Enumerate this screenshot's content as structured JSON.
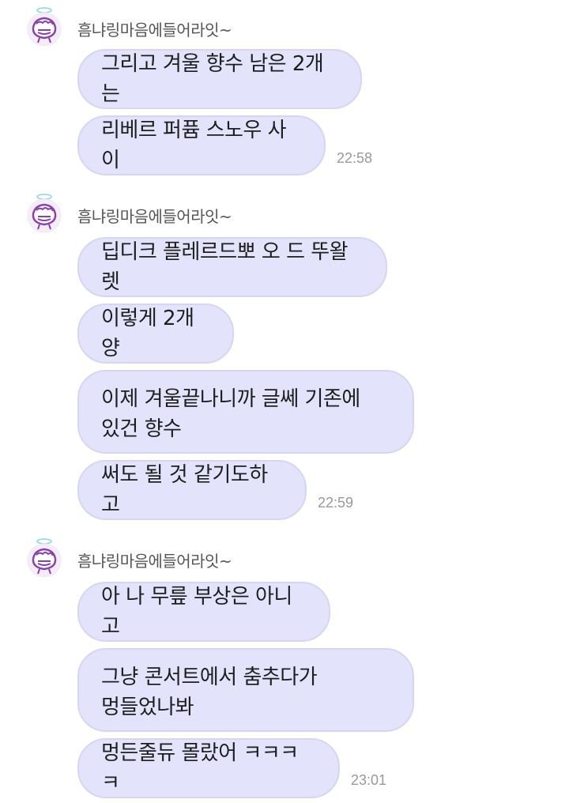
{
  "groups": [
    {
      "sender": "흠냐링마음에들어라잇~",
      "messages": [
        {
          "text": "그리고 겨울 향수 남은 2개는"
        },
        {
          "text": "리베르 퍼퓸 스노우 사이"
        }
      ],
      "time": "22:58"
    },
    {
      "sender": "흠냐링마음에들어라잇~",
      "messages": [
        {
          "text": "딥디크 플레르드뽀 오 드 뚜왈렛"
        },
        {
          "text": "이렇게 2개양"
        },
        {
          "line1": "이제 겨울끝나니까 글쎄 기존에",
          "line2": "있건 향수"
        },
        {
          "text": "써도 될 것 같기도하고"
        }
      ],
      "time": "22:59"
    },
    {
      "sender": "흠냐링마음에들어라잇~",
      "messages": [
        {
          "text": "아 나 무릎 부상은 아니고"
        },
        {
          "line1": "그냥 콘서트에서 춤추다가",
          "line2": "멍들었나봐"
        },
        {
          "text": "멍든줄듀 몰랐어 ㅋㅋㅋㅋ"
        }
      ],
      "time": "23:01"
    }
  ],
  "colors": {
    "bubble": "#e3e3fb",
    "bubble_border": "#d6d6f4",
    "avatar_accent": "#8a3fb0",
    "halo": "#8fd6e6"
  },
  "icons": {
    "avatar": "cartoon-character-with-halo-icon"
  }
}
